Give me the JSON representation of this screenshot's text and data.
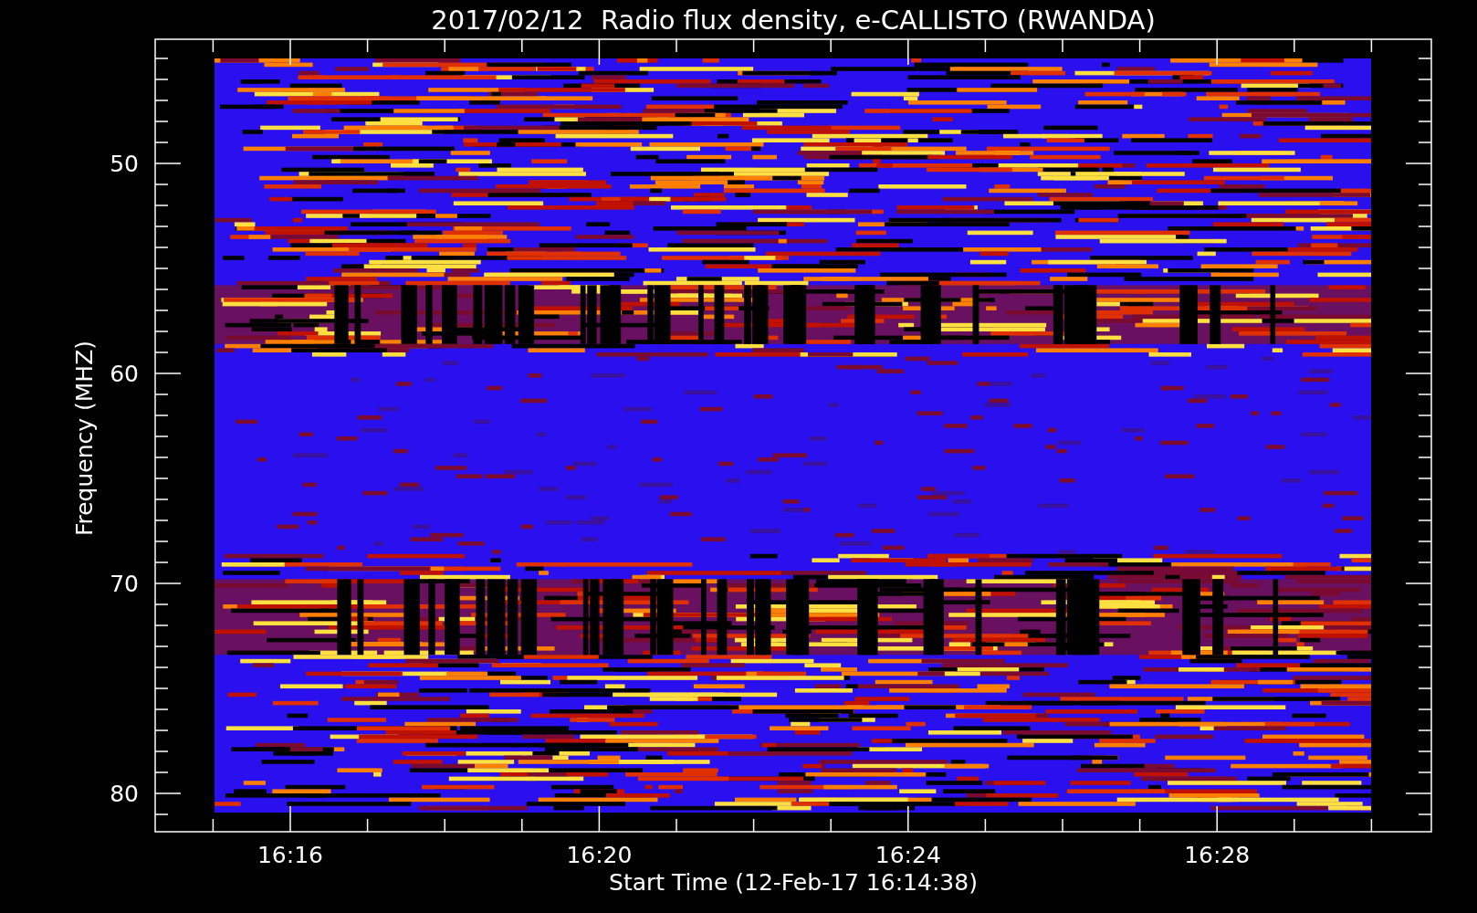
{
  "title": "2017/02/12  Radio flux density, e-CALLISTO (RWANDA)",
  "plot": {
    "ylabel": "Frequency (MHZ)",
    "xlabel": "Start Time (12-Feb-17 16:14:38)",
    "yticks": [
      "50",
      "60",
      "70",
      "80"
    ],
    "xticks": [
      "16:16",
      "16:20",
      "16:24",
      "16:28"
    ]
  }
}
